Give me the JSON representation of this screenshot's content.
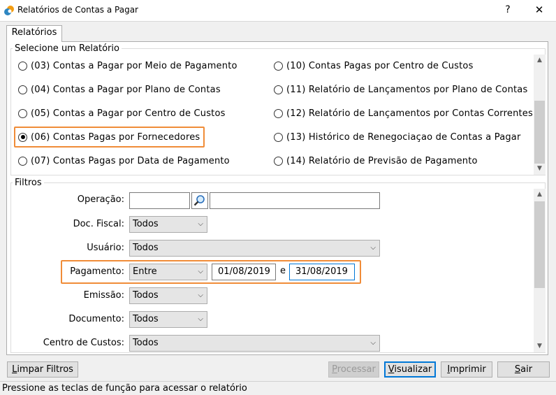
{
  "window": {
    "title": "Relatórios de Contas a Pagar",
    "help_label": "?",
    "close_label": "✕"
  },
  "tab": {
    "label": "Relatórios"
  },
  "report_group": {
    "legend": "Selecione um Relatório",
    "left_options": [
      {
        "label": "(03) Contas a Pagar por Meio de Pagamento",
        "selected": false
      },
      {
        "label": "(04) Contas a Pagar por Plano de Contas",
        "selected": false
      },
      {
        "label": "(05) Contas a Pagar por Centro de Custos",
        "selected": false
      },
      {
        "label": "(06) Contas Pagas por Fornecedores",
        "selected": true
      },
      {
        "label": "(07) Contas Pagas por Data de Pagamento",
        "selected": false
      }
    ],
    "right_options": [
      {
        "label": "(10) Contas Pagas por Centro de Custos",
        "selected": false
      },
      {
        "label": "(11) Relatório de Lançamentos por Plano de Contas",
        "selected": false
      },
      {
        "label": "(12) Relatório de Lançamentos por Contas Correntes",
        "selected": false
      },
      {
        "label": "(13) Histórico de Renegociaçao de Contas a Pagar",
        "selected": false
      },
      {
        "label": "(14) Relatório de Previsão de Pagamento",
        "selected": false
      }
    ]
  },
  "filters": {
    "legend": "Filtros",
    "operacao": {
      "label": "Operação:",
      "code": "",
      "description": ""
    },
    "doc_fiscal": {
      "label": "Doc. Fiscal:",
      "value": "Todos"
    },
    "usuario": {
      "label": "Usuário:",
      "value": "Todos"
    },
    "pagamento": {
      "label": "Pagamento:",
      "mode": "Entre",
      "from": "01/08/2019",
      "connector": "e",
      "to": "31/08/2019"
    },
    "emissao": {
      "label": "Emissão:",
      "value": "Todos"
    },
    "documento": {
      "label": "Documento:",
      "value": "Todos"
    },
    "centro_custos": {
      "label": "Centro de Custos:",
      "value": "Todos"
    }
  },
  "buttons": {
    "limpar_filtros": {
      "underline": "L",
      "rest": "impar Filtros"
    },
    "processar": {
      "underline": "P",
      "rest": "rocessar"
    },
    "visualizar": {
      "underline": "V",
      "rest": "isualizar"
    },
    "imprimir": {
      "underline": "I",
      "rest": "mprimir"
    },
    "sair": {
      "underline": "S",
      "rest": "air"
    }
  },
  "status_bar": {
    "text": "Pressione as teclas de função para acessar o relatório"
  },
  "colors": {
    "highlight": "#f08c38",
    "default_button_border": "#0078d7"
  }
}
